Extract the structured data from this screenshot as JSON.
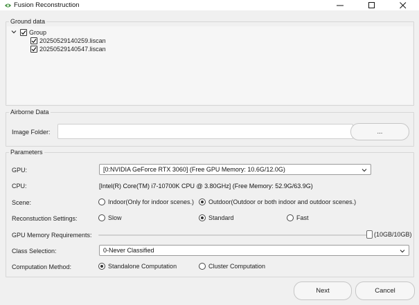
{
  "window": {
    "title": "Fusion Reconstruction",
    "accent": "#3d8a3d"
  },
  "ground": {
    "label": "Ground data",
    "group_name": "Group",
    "group_checked": true,
    "files": [
      {
        "name": "20250529140259.liscan",
        "checked": true
      },
      {
        "name": "20250529140547.liscan",
        "checked": true
      }
    ]
  },
  "airborne": {
    "label": "Airborne Data",
    "image_folder_label": "Image Folder:",
    "image_folder_value": "",
    "browse_label": "..."
  },
  "params": {
    "label": "Parameters",
    "gpu_label": "GPU:",
    "gpu_value": "[0:NVIDIA GeForce RTX 3060] (Free GPU Memory: 10.6G/12.0G)",
    "cpu_label": "CPU:",
    "cpu_value": "[Intel(R) Core(TM) i7-10700K CPU @ 3.80GHz] (Free Memory: 52.9G/63.9G)",
    "scene_label": "Scene:",
    "scene_options": [
      {
        "label": "Indoor(Only for indoor scenes.)",
        "selected": false
      },
      {
        "label": "Outdoor(Outdoor or both indoor and outdoor scenes.)",
        "selected": true
      }
    ],
    "recon_label": "Reconstuction Settings:",
    "recon_options": [
      {
        "label": "Slow",
        "selected": false
      },
      {
        "label": "Standard",
        "selected": true
      },
      {
        "label": "Fast",
        "selected": false
      }
    ],
    "gpu_mem_label": "GPU Memory Requirements:",
    "gpu_mem_fraction": 1.0,
    "gpu_mem_value": "(10GB/10GB)",
    "class_label": "Class Selection:",
    "class_value": "0-Never Classified",
    "compute_label": "Computation Method:",
    "compute_options": [
      {
        "label": "Standalone Computation",
        "selected": true
      },
      {
        "label": "Cluster Computation",
        "selected": false
      }
    ]
  },
  "footer": {
    "next_label": "Next",
    "cancel_label": "Cancel"
  }
}
